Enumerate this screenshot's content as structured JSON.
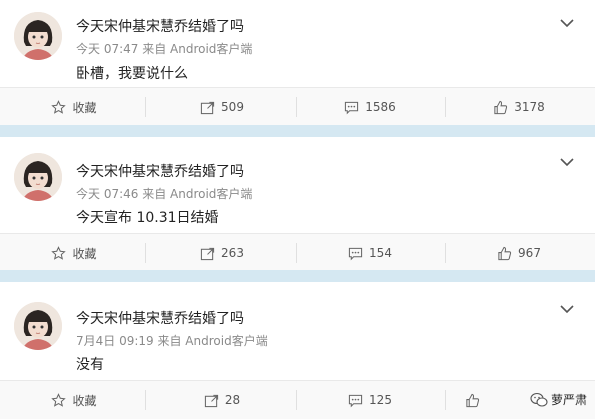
{
  "posts": [
    {
      "username": "今天宋仲基宋慧乔结婚了吗",
      "meta": "今天 07:47 来自 Android客户端",
      "content": "卧槽，我要说什么",
      "favorite_label": "收藏",
      "repost_count": "509",
      "comment_count": "1586",
      "like_count": "3178"
    },
    {
      "username": "今天宋仲基宋慧乔结婚了吗",
      "meta": "今天 07:46 来自 Android客户端",
      "content": "今天宣布 10.31日结婚",
      "favorite_label": "收藏",
      "repost_count": "263",
      "comment_count": "154",
      "like_count": "967"
    },
    {
      "username": "今天宋仲基宋慧乔结婚了吗",
      "meta": "7月4日 09:19 来自 Android客户端",
      "content": "没有",
      "favorite_label": "收藏",
      "repost_count": "28",
      "comment_count": "125",
      "like_count": ""
    }
  ],
  "watermark": "萝严肃",
  "icons": [
    "chevron-down-icon",
    "star-icon",
    "repost-icon",
    "comment-icon",
    "like-icon",
    "wechat-icon"
  ]
}
